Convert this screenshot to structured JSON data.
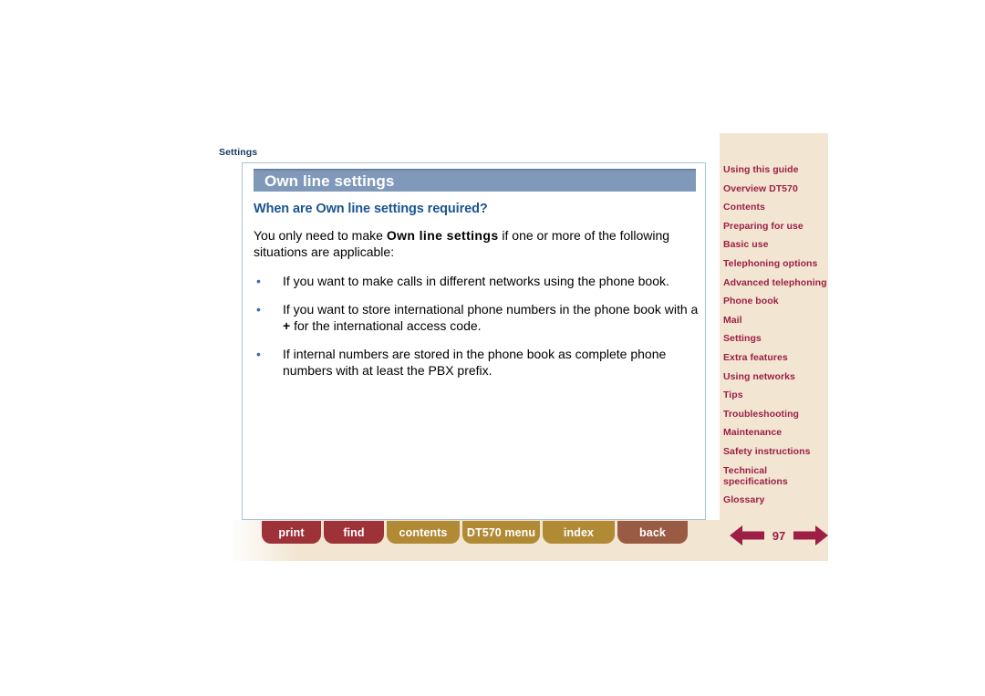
{
  "document": {
    "section_label": "Settings",
    "page_number": "97"
  },
  "content": {
    "title": "Own line settings",
    "subheading": "When are Own line settings required?",
    "intro_before": "You only need to make ",
    "intro_bold": "Own line settings",
    "intro_after": " if one or more of the following situations are applicable:",
    "bullet_marker": "•",
    "bullets": [
      {
        "text": "If you want to make calls in different networks using the phone book."
      },
      {
        "before": "If you want to store international phone numbers in the phone book with a ",
        "bold": "+",
        "after": " for the international access code."
      },
      {
        "text": "If internal numbers are stored in the phone book as complete phone numbers with at least the PBX prefix."
      }
    ]
  },
  "sidebar": {
    "items": [
      {
        "label": "Using this guide"
      },
      {
        "label": "Overview DT570"
      },
      {
        "label": "Contents"
      },
      {
        "label": "Preparing for use"
      },
      {
        "label": "Basic use"
      },
      {
        "label": "Telephoning options"
      },
      {
        "label": "Advanced telephoning"
      },
      {
        "label": "Phone book"
      },
      {
        "label": "Mail"
      },
      {
        "label": "Settings"
      },
      {
        "label": "Extra features"
      },
      {
        "label": "Using networks"
      },
      {
        "label": "Tips"
      },
      {
        "label": "Troubleshooting"
      },
      {
        "label": "Maintenance"
      },
      {
        "label": "Safety instructions"
      },
      {
        "label": "Technical\nspecifications"
      },
      {
        "label": "Glossary"
      }
    ]
  },
  "bottom_nav": {
    "buttons": [
      {
        "label": "print",
        "style": "red"
      },
      {
        "label": "find",
        "style": "red"
      },
      {
        "label": "contents",
        "style": "gold"
      },
      {
        "label": "DT570 menu",
        "style": "gold"
      },
      {
        "label": "index",
        "style": "gold"
      },
      {
        "label": "back",
        "style": "brown"
      }
    ]
  },
  "colors": {
    "sidebar_bg": "#f2e6d3",
    "sidebar_link": "#9d1f45",
    "title_bar": "#8099bb",
    "title_bar_top": "#6b7f9e",
    "subheading": "#1a5490",
    "section_label": "#1b3a62",
    "card_border": "#a8c4d4",
    "btn_red": "#9d3239",
    "btn_gold": "#b08a34",
    "btn_brown": "#9a5b45",
    "pager": "#9d1f45"
  }
}
